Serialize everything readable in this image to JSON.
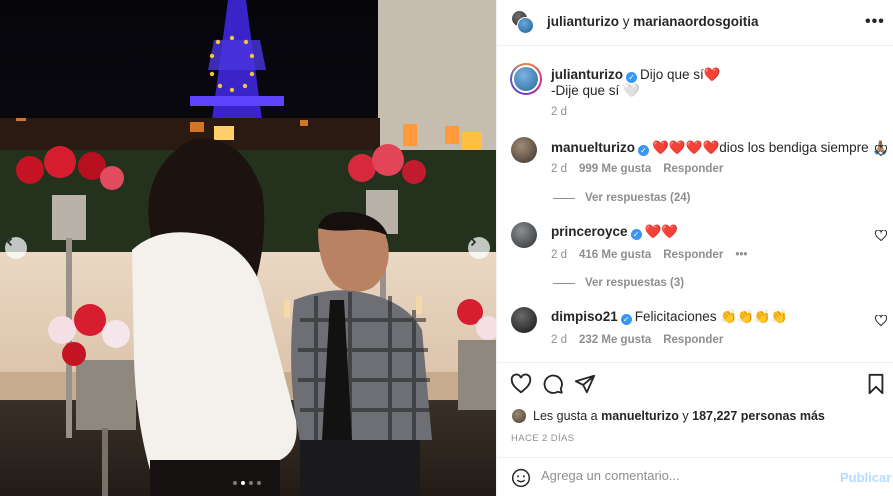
{
  "header": {
    "user_a": "julianturizo",
    "joiner": "y",
    "user_b": "marianaordosgoitia",
    "more_icon": "more-horizontal-icon"
  },
  "caption": {
    "username": "julianturizo",
    "text": "Dijo que sí❤️",
    "line2": "-Dije que sí 🤍",
    "time": "2 d"
  },
  "comments": [
    {
      "username": "manuelturizo",
      "verified": true,
      "text": "❤️❤️❤️❤️dios los bendiga siempre 🙏🏽",
      "time": "2 d",
      "likes": "999 Me gusta",
      "reply": "Responder",
      "view_replies": "Ver respuestas (24)"
    },
    {
      "username": "princeroyce",
      "verified": true,
      "text": "❤️❤️",
      "time": "2 d",
      "likes": "416 Me gusta",
      "reply": "Responder",
      "options": "•••",
      "view_replies": "Ver respuestas (3)"
    },
    {
      "username": "dimpiso21",
      "verified": true,
      "text": "Felicitaciones 👏👏👏👏",
      "time": "2 d",
      "likes": "232 Me gusta",
      "reply": "Responder"
    }
  ],
  "likes": {
    "prefix": "Les gusta a",
    "user": "manuelturizo",
    "joiner": "y",
    "count": "187,227 personas más"
  },
  "time_ago": "HACE 2 DÍAS",
  "comment_form": {
    "placeholder": "Agrega un comentario...",
    "submit_label": "Publicar"
  },
  "carousel": {
    "current": 2,
    "total": 4
  },
  "colors": {
    "verified": "#3897f0",
    "publish_disabled": "#b3dbff",
    "muted": "#8e8e8e"
  }
}
